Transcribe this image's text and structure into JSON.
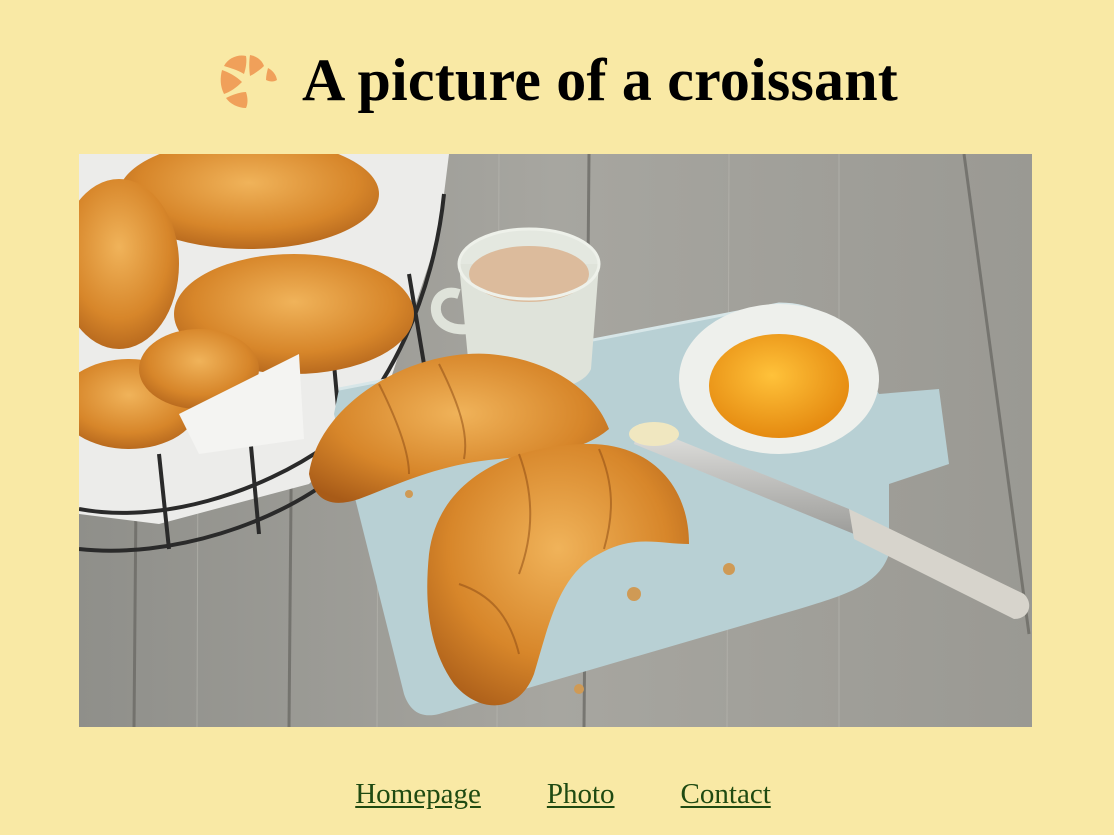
{
  "page": {
    "title": "A picture of a croissant",
    "logo_icon": "croissant-icon",
    "background_color": "#f9e9a5"
  },
  "photo": {
    "subject": "croissant-photo"
  },
  "nav": {
    "items": [
      {
        "label": "Homepage"
      },
      {
        "label": "Photo"
      },
      {
        "label": "Contact"
      }
    ],
    "link_color": "#1f4a12"
  }
}
